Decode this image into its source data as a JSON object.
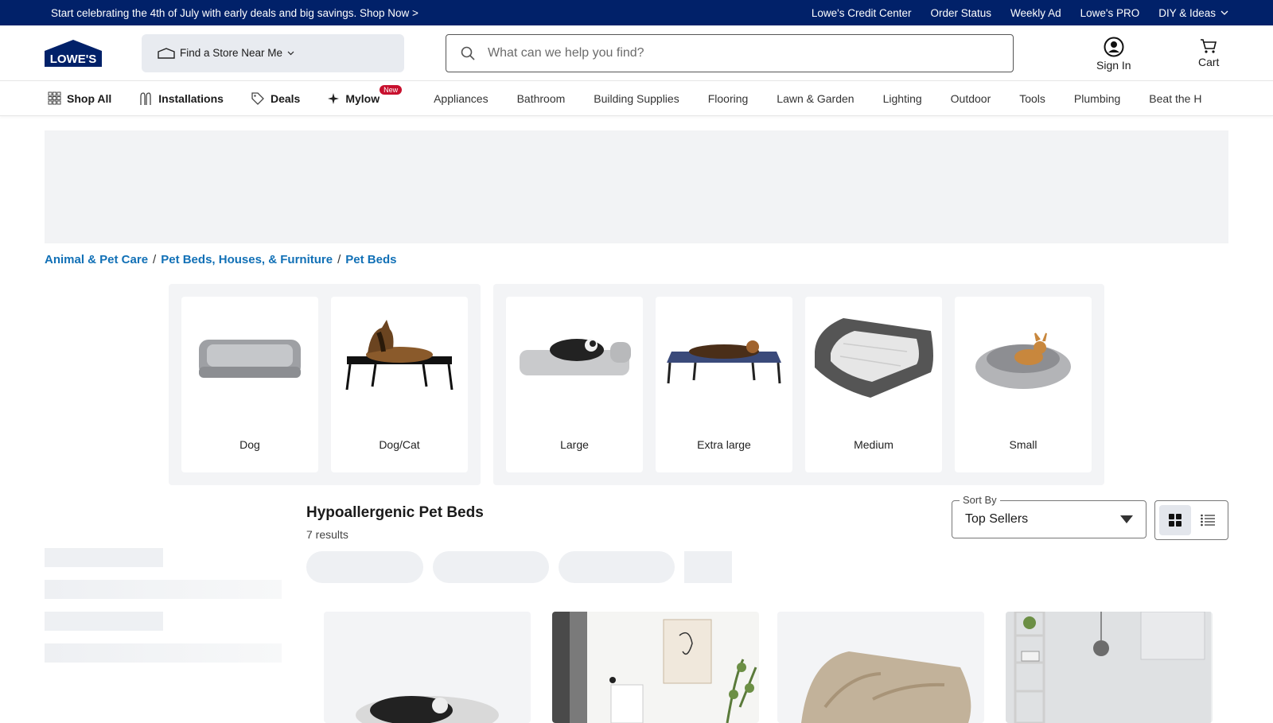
{
  "promo": {
    "text": "Start celebrating the 4th of July with early deals and big savings. Shop Now >",
    "links": [
      "Lowe's Credit Center",
      "Order Status",
      "Weekly Ad",
      "Lowe's PRO",
      "DIY & Ideas"
    ]
  },
  "header": {
    "logo_text": "LOWE'S",
    "store_label": "Find a Store Near Me",
    "search_placeholder": "What can we help you find?",
    "signin_label": "Sign In",
    "cart_label": "Cart"
  },
  "nav": {
    "shop_all": "Shop All",
    "installations": "Installations",
    "deals": "Deals",
    "mylow": "Mylow",
    "new_badge": "New",
    "categories": [
      "Appliances",
      "Bathroom",
      "Building Supplies",
      "Flooring",
      "Lawn & Garden",
      "Lighting",
      "Outdoor",
      "Tools",
      "Plumbing",
      "Beat the H"
    ]
  },
  "breadcrumb": [
    "Animal & Pet Care",
    "Pet Beds, Houses, & Furniture",
    "Pet Beds"
  ],
  "tiles": {
    "pet_type": [
      "Dog",
      "Dog/Cat"
    ],
    "size": [
      "Large",
      "Extra large",
      "Medium",
      "Small"
    ]
  },
  "results": {
    "title": "Hypoallergenic Pet Beds",
    "count": "7 results"
  },
  "sort": {
    "label": "Sort By",
    "value": "Top Sellers"
  },
  "colors": {
    "brand_navy": "#012169",
    "link_blue": "#1170b6",
    "badge_red": "#c8102e"
  }
}
